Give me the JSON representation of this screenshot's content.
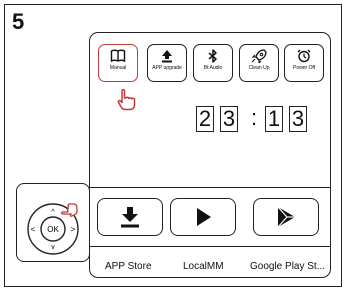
{
  "step_number": "5",
  "toolbar": [
    {
      "id": "manual",
      "label": "Manual",
      "icon": "book-icon",
      "selected": true
    },
    {
      "id": "app-upgrade",
      "label": "APP upgrade",
      "icon": "upload-icon",
      "selected": false
    },
    {
      "id": "bt-audio",
      "label": "Bt Audio",
      "icon": "bluetooth-icon",
      "selected": false
    },
    {
      "id": "clean-up",
      "label": "Clean Up",
      "icon": "rocket-icon",
      "selected": false
    },
    {
      "id": "power-off",
      "label": "Power Off",
      "icon": "alarm-clock-icon",
      "selected": false
    }
  ],
  "clock": {
    "h1": "2",
    "h2": "3",
    "sep": ":",
    "m1": "1",
    "m2": "3"
  },
  "apps": [
    {
      "label": "APP Store",
      "icon": "download-icon"
    },
    {
      "label": "LocalMM",
      "icon": "play-icon"
    },
    {
      "label": "Google Play St...",
      "icon": "google-play-icon"
    }
  ],
  "remote": {
    "ok_label": "OK",
    "left_label": "<",
    "right_label": ">",
    "up_label": "^",
    "down_label": "v"
  },
  "colors": {
    "selection": "#c23a3a",
    "stroke": "#222222"
  }
}
